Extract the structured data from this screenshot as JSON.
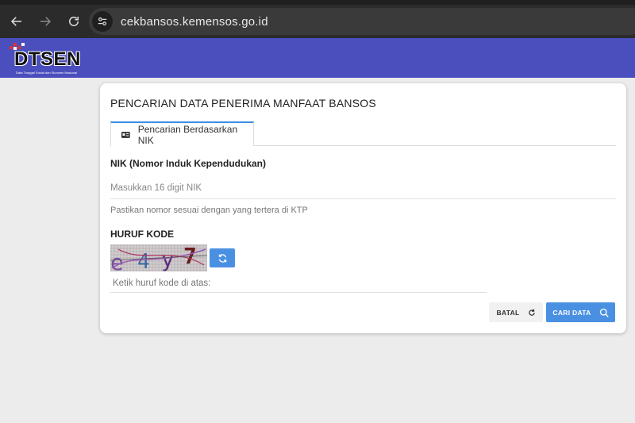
{
  "browser": {
    "url": "cekbansos.kemensos.go.id"
  },
  "header": {
    "logo_text": "DTSEN",
    "logo_tagline": "Data Tunggal Sosial dan Ekonomi Nasional"
  },
  "card": {
    "title": "PENCARIAN DATA PENERIMA MANFAAT BANSOS",
    "tab_label": "Pencarian Berdasarkan NIK",
    "nik_label": "NIK (Nomor Induk Kependudukan)",
    "nik_placeholder": "Masukkan 16 digit NIK",
    "nik_hint": "Pastikan nomor sesuai dengan yang tertera di KTP",
    "code_label": "HURUF KODE",
    "captcha_text": "e4y7",
    "code_placeholder": "Ketik huruf kode di atas:",
    "cancel_label": "BATAL",
    "search_label": "CARI DATA"
  },
  "colors": {
    "header_bg": "#4a4fbd",
    "accent": "#4a90e2"
  }
}
